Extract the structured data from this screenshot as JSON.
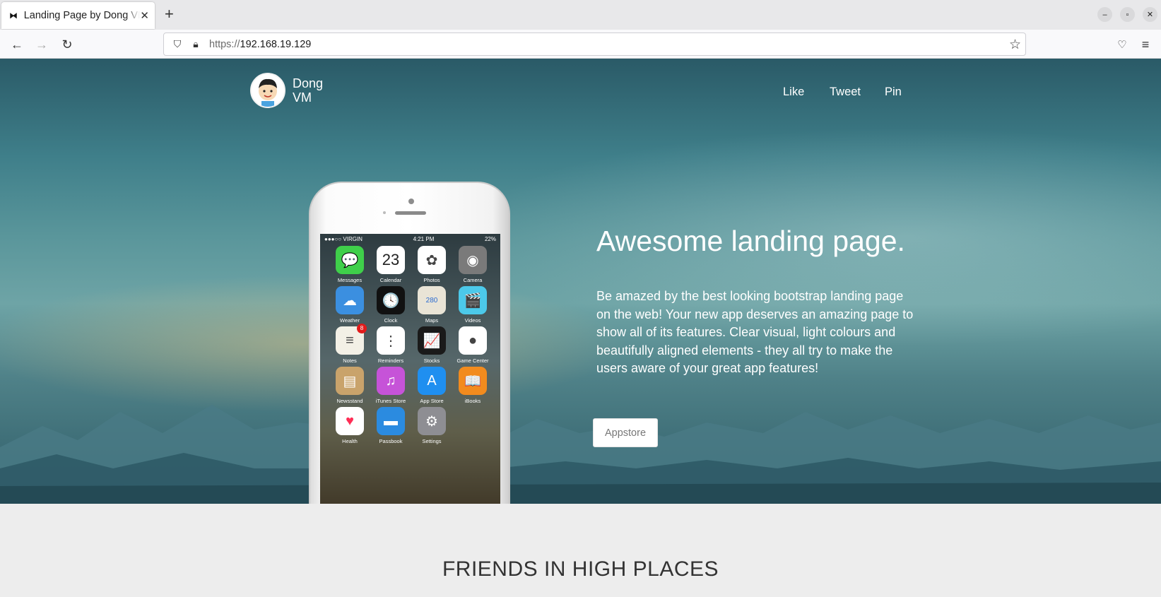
{
  "browser": {
    "tab_title": "Landing Page by Dong VM",
    "tab_close": "✕",
    "new_tab": "+",
    "url_scheme": "https://",
    "url_host": "192.168.19.129",
    "window_controls": [
      "–",
      "▫",
      "✕"
    ],
    "icons": [
      "back-arrow-icon",
      "forward-arrow-icon",
      "reload-icon",
      "shield-icon",
      "lock-icon",
      "star-icon",
      "pocket-icon",
      "menu-icon"
    ]
  },
  "site": {
    "brand_name": "Dong VM",
    "nav": [
      "Like",
      "Tweet",
      "Pin"
    ],
    "headline": "Awesome landing page.",
    "description": "Be amazed by the best looking bootstrap landing page on the web! Your new app deserves an amazing page to show all of its features. Clear visual, light colours and beautifully aligned elements - they all try to make the users aware of your great app features!",
    "cta_label": "Appstore",
    "section_title": "FRIENDS IN HIGH PLACES"
  },
  "phone": {
    "carrier": "●●●○○ VIRGIN",
    "time": "4:21 PM",
    "battery": "22%",
    "apps": [
      {
        "label": "Messages",
        "glyph": "💬",
        "color": "#3fcf4a"
      },
      {
        "label": "Calendar",
        "glyph": "23",
        "color": "#ffffff"
      },
      {
        "label": "Photos",
        "glyph": "✿",
        "color": "#ffffff"
      },
      {
        "label": "Camera",
        "glyph": "◉",
        "color": "#7a7a7a"
      },
      {
        "label": "Weather",
        "glyph": "☁",
        "color": "#3b8fe0"
      },
      {
        "label": "Clock",
        "glyph": "🕓",
        "color": "#111111"
      },
      {
        "label": "Maps",
        "glyph": "280",
        "color": "#e9e4d6"
      },
      {
        "label": "Videos",
        "glyph": "🎬",
        "color": "#4cc9ea"
      },
      {
        "label": "Notes",
        "glyph": "≡",
        "color": "#f3f0e6",
        "badge": "8"
      },
      {
        "label": "Reminders",
        "glyph": "⋮",
        "color": "#ffffff"
      },
      {
        "label": "Stocks",
        "glyph": "📈",
        "color": "#1a1a1a"
      },
      {
        "label": "Game Center",
        "glyph": "●",
        "color": "#ffffff"
      },
      {
        "label": "Newsstand",
        "glyph": "▤",
        "color": "#c9a36b"
      },
      {
        "label": "iTunes Store",
        "glyph": "♫",
        "color": "#c653d8"
      },
      {
        "label": "App Store",
        "glyph": "A",
        "color": "#1f8ff0"
      },
      {
        "label": "iBooks",
        "glyph": "📖",
        "color": "#f28b1e"
      },
      {
        "label": "Health",
        "glyph": "♥",
        "color": "#ffffff"
      },
      {
        "label": "Passbook",
        "glyph": "▬",
        "color": "#2b8be0"
      },
      {
        "label": "Settings",
        "glyph": "⚙",
        "color": "#8e8e93"
      }
    ]
  }
}
